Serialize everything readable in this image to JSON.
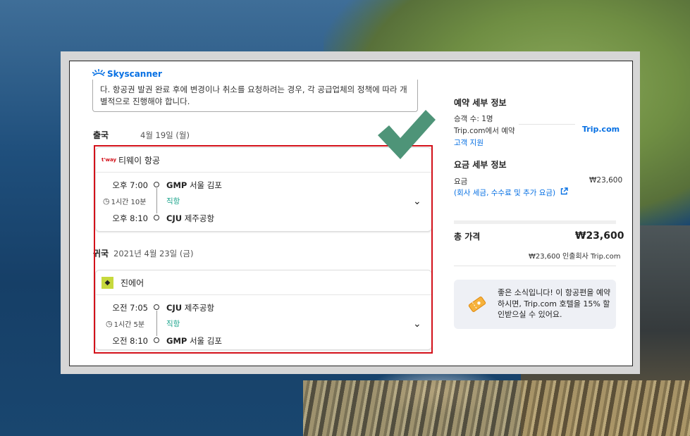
{
  "brand": {
    "logo_text": "Skyscanner",
    "accent": "#0770e3",
    "highlight_red": "#d3111a",
    "check_green": "#4e9478"
  },
  "notice": {
    "text": "다. 항공권 발권 완료 후에 변경이나 취소를 요청하려는 경우, 각 공급업체의 정책에 따라 개별적으로 진행해야 합니다."
  },
  "outbound": {
    "label": "출국",
    "date": "4월 19일 (월)",
    "airline": "티웨이 항공",
    "airline_logo": "t'way",
    "depart_time": "오후 7:00",
    "depart_code": "GMP",
    "depart_name": "서울 김포",
    "duration": "1시간 10분",
    "stops": "직항",
    "arrive_time": "오후 8:10",
    "arrive_code": "CJU",
    "arrive_name": "제주공항"
  },
  "inbound": {
    "label": "귀국",
    "date": "2021년 4월 23일 (금)",
    "airline": "진에어",
    "depart_time": "오전 7:05",
    "depart_code": "CJU",
    "depart_name": "제주공항",
    "duration": "1시간 5분",
    "stops": "직항",
    "arrive_time": "오전 8:10",
    "arrive_code": "GMP",
    "arrive_name": "서울 김포"
  },
  "booking": {
    "title": "예약 세부 정보",
    "passengers": "승객 수: 1명",
    "booked_via": "Trip.com에서 예약",
    "provider": "Trip.com",
    "support_link": "고객 지원"
  },
  "fare": {
    "title": "요금 세부 정보",
    "fare_label": "요금",
    "fare_value": "₩23,600",
    "fees_link": "(회사 세금, 수수료 및 추가 요금)"
  },
  "total": {
    "label": "총 가격",
    "value": "₩23,600",
    "note": "₩23,600 인출회사 Trip.com"
  },
  "promo": {
    "text": "좋은 소식입니다! 이 항공편을 예약하시면, Trip.com 호텔을 15% 할인받으실 수 있어요."
  }
}
